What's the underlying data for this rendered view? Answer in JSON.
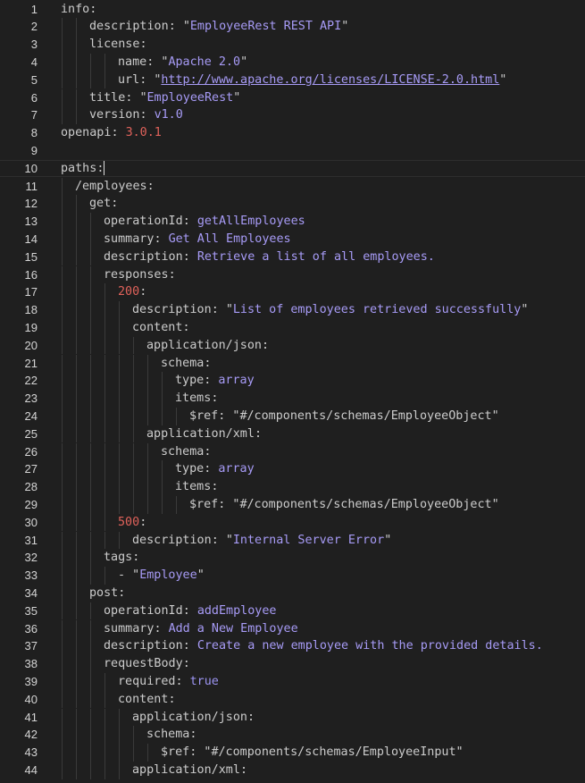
{
  "editor": {
    "lines": [
      {
        "num": "1",
        "indent": 0,
        "key": "info",
        "sep": ":",
        "val": "",
        "vtype": ""
      },
      {
        "num": "2",
        "indent": 2,
        "key": "description",
        "sep": ": ",
        "val": "EmployeeRest REST API",
        "vtype": "qs"
      },
      {
        "num": "3",
        "indent": 2,
        "key": "license",
        "sep": ":",
        "val": "",
        "vtype": ""
      },
      {
        "num": "4",
        "indent": 4,
        "key": "name",
        "sep": ": ",
        "val": "Apache 2.0",
        "vtype": "qs"
      },
      {
        "num": "5",
        "indent": 4,
        "key": "url",
        "sep": ": ",
        "val": "http://www.apache.org/licenses/LICENSE-2.0.html",
        "vtype": "qu"
      },
      {
        "num": "6",
        "indent": 2,
        "key": "title",
        "sep": ": ",
        "val": "EmployeeRest",
        "vtype": "qs"
      },
      {
        "num": "7",
        "indent": 2,
        "key": "version",
        "sep": ": ",
        "val": "v1.0",
        "vtype": "s"
      },
      {
        "num": "8",
        "indent": 0,
        "key": "openapi",
        "sep": ": ",
        "val": "3.0.1",
        "vtype": "n"
      },
      {
        "num": "9",
        "indent": 0,
        "key": "",
        "sep": "",
        "val": "",
        "vtype": ""
      },
      {
        "num": "10",
        "indent": 0,
        "key": "paths",
        "sep": ":",
        "val": "",
        "vtype": "",
        "current": true
      },
      {
        "num": "11",
        "indent": 1,
        "key": "/employees",
        "sep": ":",
        "val": "",
        "vtype": ""
      },
      {
        "num": "12",
        "indent": 2,
        "key": "get",
        "sep": ":",
        "val": "",
        "vtype": ""
      },
      {
        "num": "13",
        "indent": 3,
        "key": "operationId",
        "sep": ": ",
        "val": "getAllEmployees",
        "vtype": "s"
      },
      {
        "num": "14",
        "indent": 3,
        "key": "summary",
        "sep": ": ",
        "val": "Get All Employees",
        "vtype": "s"
      },
      {
        "num": "15",
        "indent": 3,
        "key": "description",
        "sep": ": ",
        "val": "Retrieve a list of all employees.",
        "vtype": "s"
      },
      {
        "num": "16",
        "indent": 3,
        "key": "responses",
        "sep": ":",
        "val": "",
        "vtype": ""
      },
      {
        "num": "17",
        "indent": 4,
        "key": "200",
        "sep": ":",
        "val": "",
        "vtype": "",
        "keytype": "n"
      },
      {
        "num": "18",
        "indent": 5,
        "key": "description",
        "sep": ": ",
        "val": "List of employees retrieved successfully",
        "vtype": "qs"
      },
      {
        "num": "19",
        "indent": 5,
        "key": "content",
        "sep": ":",
        "val": "",
        "vtype": ""
      },
      {
        "num": "20",
        "indent": 6,
        "key": "application/json",
        "sep": ":",
        "val": "",
        "vtype": ""
      },
      {
        "num": "21",
        "indent": 7,
        "key": "schema",
        "sep": ":",
        "val": "",
        "vtype": ""
      },
      {
        "num": "22",
        "indent": 8,
        "key": "type",
        "sep": ": ",
        "val": "array",
        "vtype": "s"
      },
      {
        "num": "23",
        "indent": 8,
        "key": "items",
        "sep": ":",
        "val": "",
        "vtype": ""
      },
      {
        "num": "24",
        "indent": 9,
        "key": "$ref",
        "sep": ": ",
        "val": "#/components/schemas/EmployeeObject",
        "vtype": "qp"
      },
      {
        "num": "25",
        "indent": 6,
        "key": "application/xml",
        "sep": ":",
        "val": "",
        "vtype": ""
      },
      {
        "num": "26",
        "indent": 7,
        "key": "schema",
        "sep": ":",
        "val": "",
        "vtype": ""
      },
      {
        "num": "27",
        "indent": 8,
        "key": "type",
        "sep": ": ",
        "val": "array",
        "vtype": "s"
      },
      {
        "num": "28",
        "indent": 8,
        "key": "items",
        "sep": ":",
        "val": "",
        "vtype": ""
      },
      {
        "num": "29",
        "indent": 9,
        "key": "$ref",
        "sep": ": ",
        "val": "#/components/schemas/EmployeeObject",
        "vtype": "qp"
      },
      {
        "num": "30",
        "indent": 4,
        "key": "500",
        "sep": ":",
        "val": "",
        "vtype": "",
        "keytype": "n"
      },
      {
        "num": "31",
        "indent": 5,
        "key": "description",
        "sep": ": ",
        "val": "Internal Server Error",
        "vtype": "qs"
      },
      {
        "num": "32",
        "indent": 3,
        "key": "tags",
        "sep": ":",
        "val": "",
        "vtype": ""
      },
      {
        "num": "33",
        "indent": 4,
        "key": "- ",
        "sep": "",
        "val": "Employee",
        "vtype": "qs",
        "keytype": "dash"
      },
      {
        "num": "34",
        "indent": 2,
        "key": "post",
        "sep": ":",
        "val": "",
        "vtype": ""
      },
      {
        "num": "35",
        "indent": 3,
        "key": "operationId",
        "sep": ": ",
        "val": "addEmployee",
        "vtype": "s"
      },
      {
        "num": "36",
        "indent": 3,
        "key": "summary",
        "sep": ": ",
        "val": "Add a New Employee",
        "vtype": "s"
      },
      {
        "num": "37",
        "indent": 3,
        "key": "description",
        "sep": ": ",
        "val": "Create a new employee with the provided details.",
        "vtype": "s"
      },
      {
        "num": "38",
        "indent": 3,
        "key": "requestBody",
        "sep": ":",
        "val": "",
        "vtype": ""
      },
      {
        "num": "39",
        "indent": 4,
        "key": "required",
        "sep": ": ",
        "val": "true",
        "vtype": "b"
      },
      {
        "num": "40",
        "indent": 4,
        "key": "content",
        "sep": ":",
        "val": "",
        "vtype": ""
      },
      {
        "num": "41",
        "indent": 5,
        "key": "application/json",
        "sep": ":",
        "val": "",
        "vtype": ""
      },
      {
        "num": "42",
        "indent": 6,
        "key": "schema",
        "sep": ":",
        "val": "",
        "vtype": ""
      },
      {
        "num": "43",
        "indent": 7,
        "key": "$ref",
        "sep": ": ",
        "val": "#/components/schemas/EmployeeInput",
        "vtype": "qp"
      },
      {
        "num": "44",
        "indent": 5,
        "key": "application/xml",
        "sep": ":",
        "val": "",
        "vtype": ""
      }
    ]
  },
  "colors": {
    "background": "#1f1f1f",
    "key": "#cccccc",
    "string": "#a79bf6",
    "number": "#e0625b",
    "guide": "#3a3a3a"
  }
}
